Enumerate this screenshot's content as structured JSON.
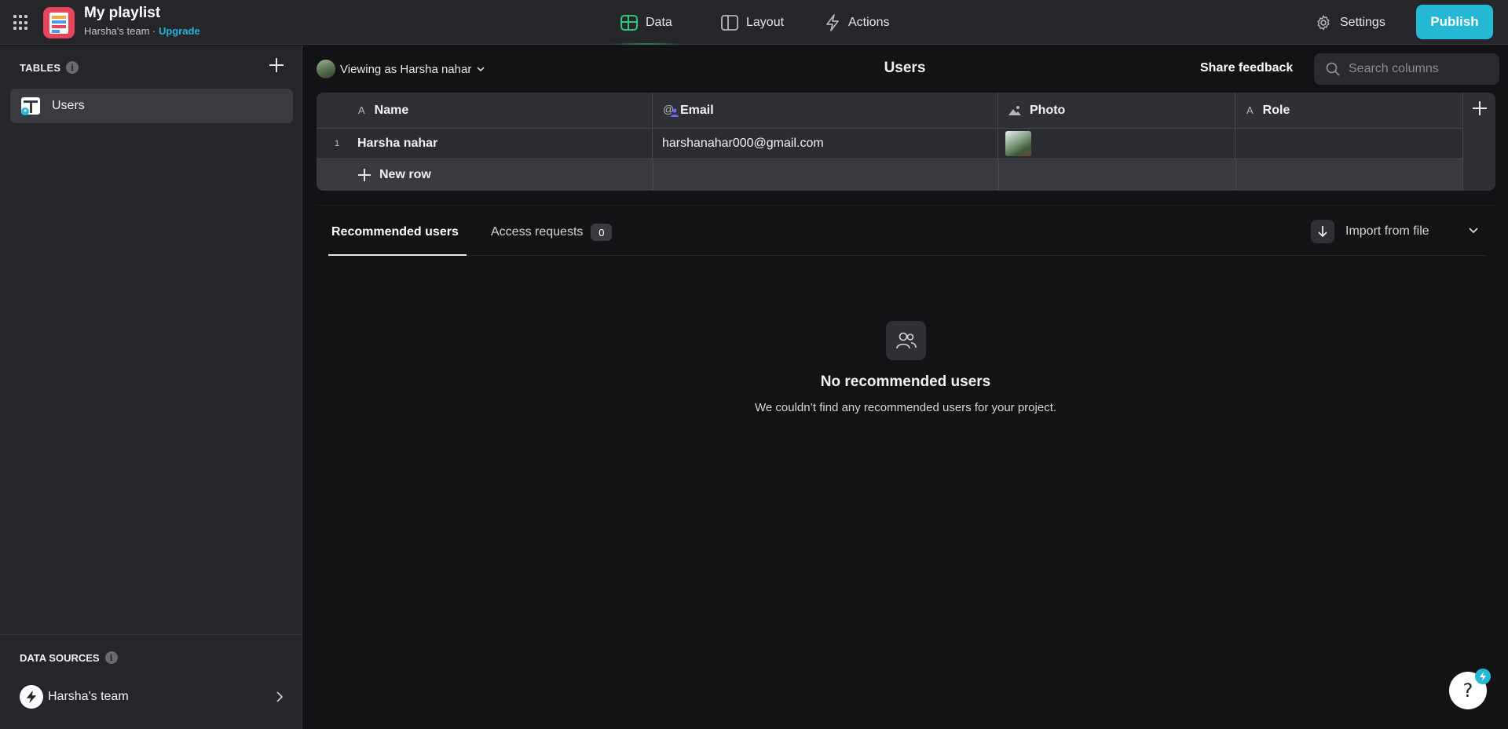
{
  "app": {
    "title": "My playlist",
    "team": "Harsha's team",
    "separator": " · ",
    "upgrade": "Upgrade"
  },
  "nav": {
    "data": "Data",
    "layout": "Layout",
    "actions": "Actions",
    "settings": "Settings",
    "publish": "Publish"
  },
  "sidebar": {
    "tables_heading": "TABLES",
    "tables": [
      {
        "label": "Users"
      }
    ],
    "data_sources_heading": "DATA SOURCES",
    "data_source": "Harsha's team"
  },
  "header": {
    "viewing_as": "Viewing as Harsha nahar",
    "title": "Users",
    "share_feedback": "Share feedback",
    "search_placeholder": "Search columns"
  },
  "table": {
    "columns": [
      {
        "type_icon": "A",
        "label": "Name"
      },
      {
        "type_icon": "@",
        "label": "Email"
      },
      {
        "type_icon": "image-icon",
        "label": "Photo"
      },
      {
        "type_icon": "A",
        "label": "Role"
      }
    ],
    "rows": [
      {
        "num": "1",
        "name": "Harsha nahar",
        "email": "harshanahar000@gmail.com",
        "photo": "photo-thumbnail",
        "role": ""
      }
    ],
    "new_row": "New row"
  },
  "tabs": {
    "recommended": "Recommended users",
    "access_requests": "Access requests",
    "access_count": "0",
    "import": "Import from file"
  },
  "empty": {
    "title": "No recommended users",
    "description": "We couldn’t find any recommended users for your project."
  },
  "help": {
    "label": "?"
  },
  "colors": {
    "accent": "#24b8d4",
    "data_icon": "#2ec47a",
    "app_icon": "#e8455d"
  }
}
